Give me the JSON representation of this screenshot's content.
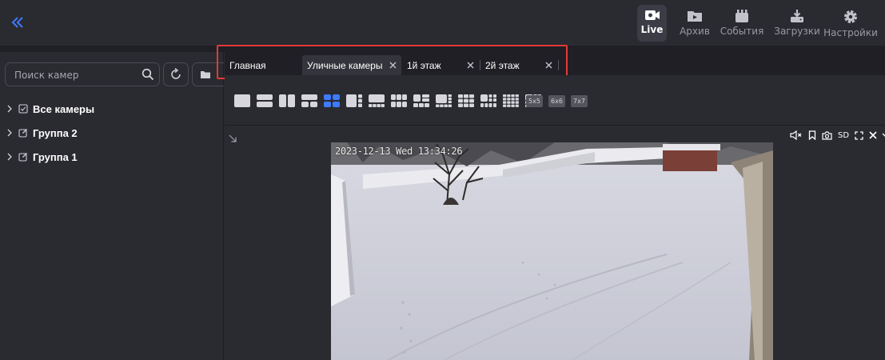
{
  "nav": {
    "live": "Live",
    "archive": "Архив",
    "events": "События",
    "downloads": "Загрузки",
    "settings": "Настройки"
  },
  "sidebar": {
    "search_placeholder": "Поиск камер",
    "tree": [
      {
        "label": "Все камеры",
        "icon": "checkbox-icon"
      },
      {
        "label": "Группа 2",
        "icon": "edit-icon"
      },
      {
        "label": "Группа 1",
        "icon": "edit-icon"
      }
    ]
  },
  "tabs": [
    {
      "label": "Главная",
      "active": false,
      "closable": false
    },
    {
      "label": "Уличные камеры",
      "active": true,
      "closable": true
    },
    {
      "label": "1й этаж",
      "active": false,
      "closable": true
    },
    {
      "label": "2й этаж",
      "active": false,
      "closable": true
    }
  ],
  "layouts": {
    "text_buttons": [
      "5x5",
      "6x6",
      "7x7"
    ],
    "selected": "2x2"
  },
  "video": {
    "timestamp": "2023-12-13 Wed 13:34:26",
    "quality": "SD"
  },
  "colors": {
    "accent": "#3d7bff",
    "highlight": "#e53935"
  }
}
